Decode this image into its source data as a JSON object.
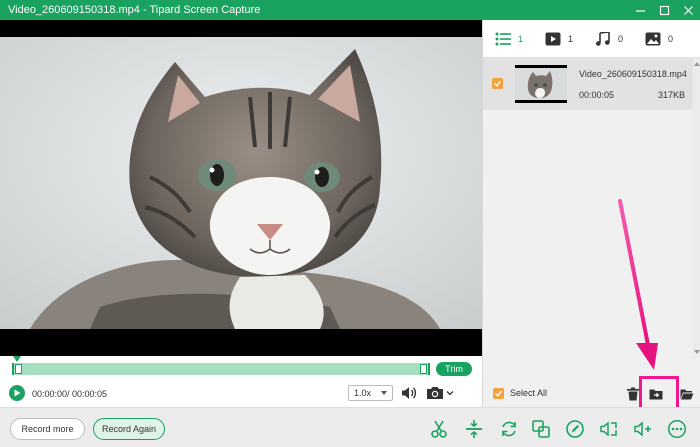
{
  "window": {
    "title": "Video_260609150318.mp4   -   Tipard Screen Capture"
  },
  "filters": [
    {
      "icon": "list-icon",
      "count": "1"
    },
    {
      "icon": "video-icon",
      "count": "1"
    },
    {
      "icon": "music-icon",
      "count": "0"
    },
    {
      "icon": "image-icon",
      "count": "0"
    }
  ],
  "files": [
    {
      "name": "Video_260609150318.mp4",
      "duration": "00:00:05",
      "size": "317KB"
    }
  ],
  "player": {
    "time": "00:00:00/ 00:00:05",
    "speed": "1.0x",
    "trim_label": "Trim"
  },
  "list_footer": {
    "select_all": "Select All"
  },
  "buttons": {
    "record_more": "Record more",
    "record_again": "Record Again"
  },
  "colors": {
    "accent": "#1aa260",
    "checkbox": "#f2a23c",
    "highlight": "#f0178f"
  }
}
